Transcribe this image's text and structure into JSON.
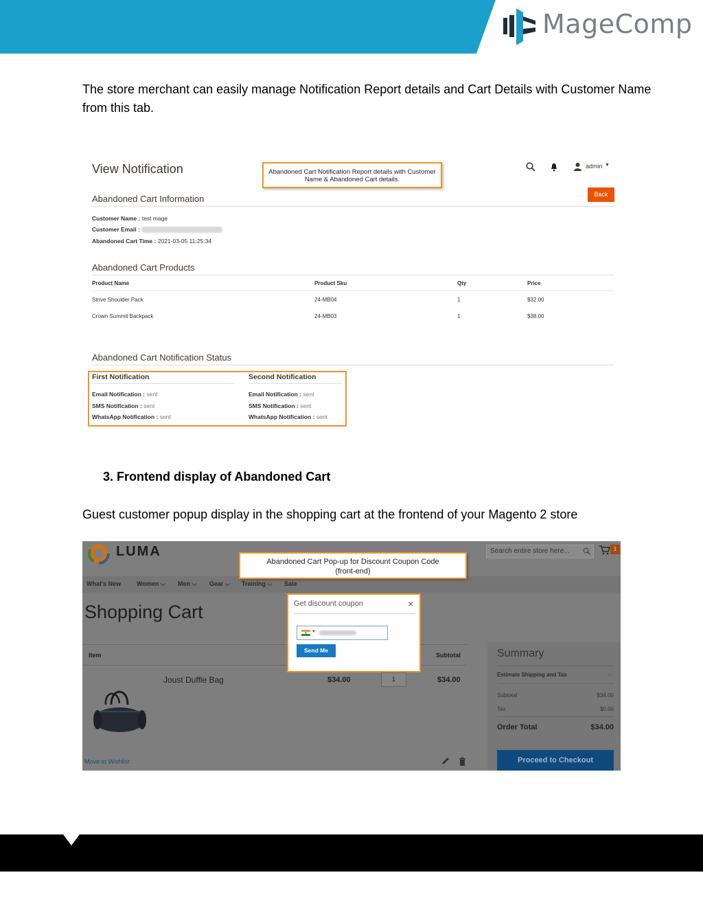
{
  "brand": {
    "name": "MageComp"
  },
  "intro_paragraph": [
    "The store merchant can easily manage Notification Report details and Cart Details with Customer Name",
    "from this tab."
  ],
  "admin_view": {
    "title": "View Notification",
    "callout": [
      "Abandoned Cart Notification Report details with Customer",
      "Name & Abandoned Cart details."
    ],
    "user_label": "admin",
    "back_label": "Back",
    "info_heading": "Abandoned Cart Information",
    "customer_name_label": "Customer Name :",
    "customer_name_value": "test mage",
    "customer_email_label": "Customer Email :",
    "cart_time_label": "Abandoned Cart Time :",
    "cart_time_value": "2021-03-05 11:25:34",
    "products_heading": "Abandoned Cart Products",
    "columns": [
      "Product Name",
      "Product Sku",
      "Qty",
      "Price"
    ],
    "products": [
      {
        "name": "Strive Shoulder Pack",
        "sku": "24-MB04",
        "qty": "1",
        "price": "$32.00"
      },
      {
        "name": "Crown Summit Backpack",
        "sku": "24-MB03",
        "qty": "1",
        "price": "$38.00"
      }
    ],
    "status_heading": "Abandoned Cart Notification Status",
    "first_heading": "First Notification",
    "second_heading": "Second Notification",
    "first": [
      {
        "label": "Email Notification :",
        "value": "sent"
      },
      {
        "label": "SMS Notification :",
        "value": "sent"
      },
      {
        "label": "WhatsApp Notification :",
        "value": "sent"
      }
    ],
    "second": [
      {
        "label": "Email Notification :",
        "value": "sent"
      },
      {
        "label": "SMS Notification :",
        "value": "sent"
      },
      {
        "label": "WhatsApp Notification :",
        "value": "sent"
      }
    ]
  },
  "step_heading": "3.   Frontend display of Abandoned Cart",
  "frontend_paragraph": "Guest customer popup display in the shopping cart at the frontend of your Magento 2 store",
  "luma": {
    "logo_text": "LUMA",
    "search_placeholder": "Search entire store here...",
    "cart_count": "1",
    "callout": [
      "Abandoned Cart  Pop-up for Discount Coupon Code",
      "(front-end)"
    ],
    "nav": [
      "What's New",
      "Women",
      "Men",
      "Gear",
      "Training",
      "Sale"
    ],
    "page_title": "Shopping Cart",
    "col_item": "Item",
    "col_subtotal": "Subtotal",
    "product_name": "Joust Duffle Bag",
    "product_price": "$34.00",
    "product_qty": "1",
    "product_subtotal": "$34.00",
    "move_to_wishlist": "Move to Wishlist",
    "summary": {
      "title": "Summary",
      "estimate": "Estimate Shipping and Tax",
      "subtotal_label": "Subtotal",
      "subtotal_value": "$34.00",
      "tax_label": "Tax",
      "tax_value": "$0.00",
      "order_total_label": "Order Total",
      "order_total_value": "$34.00",
      "checkout_label": "Proceed to Checkout"
    },
    "popup": {
      "title": "Get discount coupon",
      "send_label": "Send Me"
    }
  },
  "colors": {
    "header": "#1aa0cb",
    "callout_border": "#f0932b",
    "back_button": "#eb5202",
    "send_button": "#1979c3"
  }
}
